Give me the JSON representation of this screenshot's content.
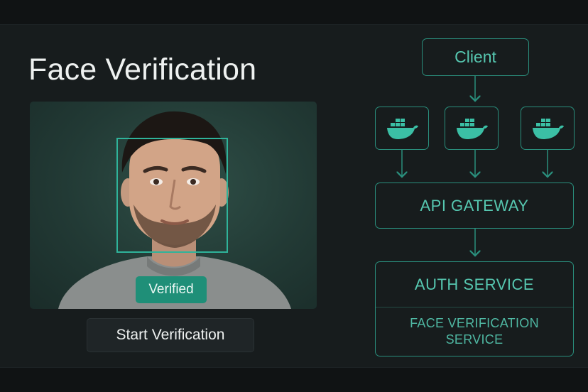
{
  "left_panel": {
    "title": "Face Verification",
    "status_badge": "Verified",
    "start_button": "Start Verification"
  },
  "diagram": {
    "client": "Client",
    "container_icons": [
      "docker-icon",
      "docker-icon",
      "docker-icon"
    ],
    "gateway": "API GATEWAY",
    "auth_service": "AUTH SERVICE",
    "face_service": "FACE VERIFICATION SERVICE"
  },
  "colors": {
    "background": "#171c1d",
    "accent": "#2fb39a",
    "badge": "#1f8f78",
    "diagram_text": "#56c7b0"
  }
}
